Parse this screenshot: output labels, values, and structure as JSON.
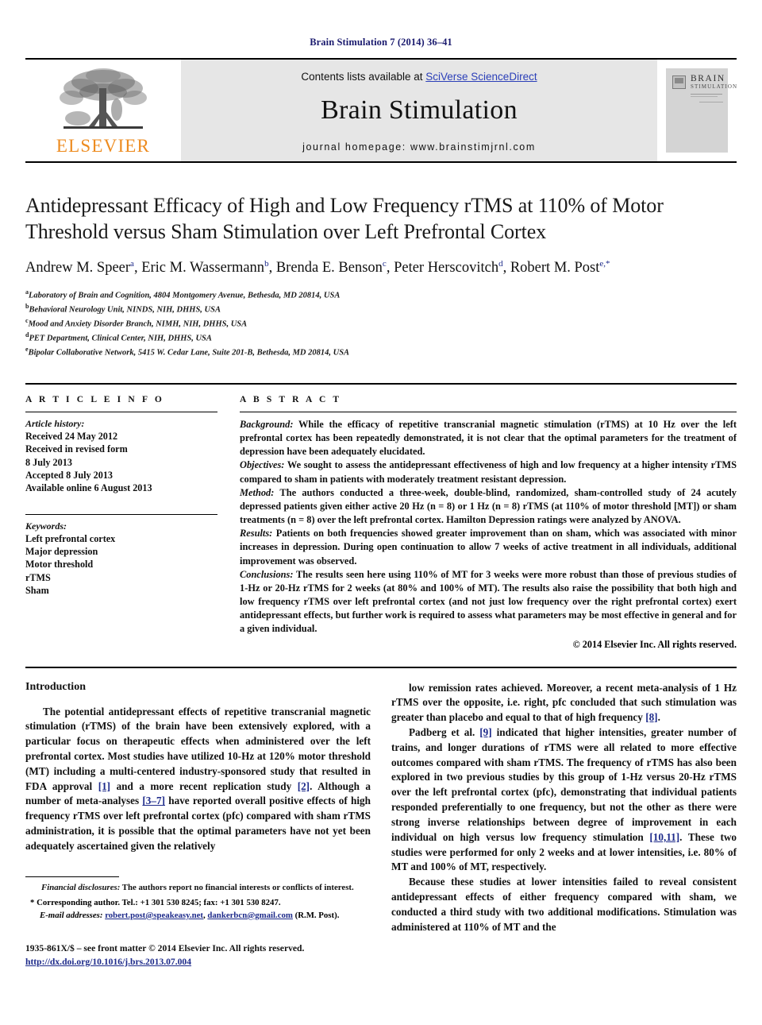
{
  "running_head": "Brain Stimulation 7 (2014) 36–41",
  "masthead": {
    "contents_prefix": "Contents lists available at ",
    "sciencedirect": "SciVerse ScienceDirect",
    "journal_name": "Brain Stimulation",
    "homepage": "journal homepage: www.brainstimjrnl.com",
    "publisher_word": "ELSEVIER",
    "cover": {
      "line1": "BRAIN",
      "line2": "STIMULATION"
    }
  },
  "article": {
    "title": "Antidepressant Efficacy of High and Low Frequency rTMS at 110% of Motor Threshold versus Sham Stimulation over Left Prefrontal Cortex",
    "authors": [
      {
        "name": "Andrew M. Speer",
        "sup": "a",
        "sep": ", "
      },
      {
        "name": "Eric M. Wassermann",
        "sup": "b",
        "sep": ", "
      },
      {
        "name": "Brenda E. Benson",
        "sup": "c",
        "sep": ", "
      },
      {
        "name": "Peter Herscovitch",
        "sup": "d",
        "sep": ", "
      },
      {
        "name": "Robert M. Post",
        "sup": "e,*",
        "sep": ""
      }
    ],
    "affiliations": [
      {
        "sup": "a",
        "text": "Laboratory of Brain and Cognition, 4804 Montgomery Avenue, Bethesda, MD 20814, USA"
      },
      {
        "sup": "b",
        "text": "Behavioral Neurology Unit, NINDS, NIH, DHHS, USA"
      },
      {
        "sup": "c",
        "text": "Mood and Anxiety Disorder Branch, NIMH, NIH, DHHS, USA"
      },
      {
        "sup": "d",
        "text": "PET Department, Clinical Center, NIH, DHHS, USA"
      },
      {
        "sup": "e",
        "text": "Bipolar Collaborative Network, 5415 W. Cedar Lane, Suite 201-B, Bethesda, MD 20814, USA"
      }
    ]
  },
  "info": {
    "heading": "A R T I C L E   I N F O",
    "history_label": "Article history:",
    "history": [
      "Received 24 May 2012",
      "Received in revised form",
      "8 July 2013",
      "Accepted 8 July 2013",
      "Available online 6 August 2013"
    ],
    "keywords_label": "Keywords:",
    "keywords": [
      "Left prefrontal cortex",
      "Major depression",
      "Motor threshold",
      "rTMS",
      "Sham"
    ]
  },
  "abstract": {
    "heading": "A B S T R A C T",
    "sections": [
      {
        "label": "Background:",
        "text": " While the efficacy of repetitive transcranial magnetic stimulation (rTMS) at 10 Hz over the left prefrontal cortex has been repeatedly demonstrated, it is not clear that the optimal parameters for the treatment of depression have been adequately elucidated."
      },
      {
        "label": "Objectives:",
        "text": " We sought to assess the antidepressant effectiveness of high and low frequency at a higher intensity rTMS compared to sham in patients with moderately treatment resistant depression."
      },
      {
        "label": "Method:",
        "text": " The authors conducted a three-week, double-blind, randomized, sham-controlled study of 24 acutely depressed patients given either active 20 Hz (n = 8) or 1 Hz (n = 8) rTMS (at 110% of motor threshold [MT]) or sham treatments (n = 8) over the left prefrontal cortex. Hamilton Depression ratings were analyzed by ANOVA."
      },
      {
        "label": "Results:",
        "text": " Patients on both frequencies showed greater improvement than on sham, which was associated with minor increases in depression. During open continuation to allow 7 weeks of active treatment in all individuals, additional improvement was observed."
      },
      {
        "label": "Conclusions:",
        "text": " The results seen here using 110% of MT for 3 weeks were more robust than those of previous studies of 1-Hz or 20-Hz rTMS for 2 weeks (at 80% and 100% of MT). The results also raise the possibility that both high and low frequency rTMS over left prefrontal cortex (and not just low frequency over the right prefrontal cortex) exert antidepressant effects, but further work is required to assess what parameters may be most effective in general and for a given individual."
      }
    ],
    "copyright": "© 2014 Elsevier Inc. All rights reserved."
  },
  "body": {
    "intro_heading": "Introduction",
    "left_paragraphs": [
      "The potential antidepressant effects of repetitive transcranial magnetic stimulation (rTMS) of the brain have been extensively explored, with a particular focus on therapeutic effects when administered over the left prefrontal cortex. Most studies have utilized 10-Hz at 120% motor threshold (MT) including a multi-centered industry-sponsored study that resulted in FDA approval [1] and a more recent replication study [2]. Although a number of meta-analyses [3–7] have reported overall positive effects of high frequency rTMS over left prefrontal cortex (pfc) compared with sham rTMS administration, it is possible that the optimal parameters have not yet been adequately ascertained given the relatively"
    ],
    "right_paragraphs": [
      "low remission rates achieved. Moreover, a recent meta-analysis of 1 Hz rTMS over the opposite, i.e. right, pfc concluded that such stimulation was greater than placebo and equal to that of high frequency [8].",
      "Padberg et al. [9] indicated that higher intensities, greater number of trains, and longer durations of rTMS were all related to more effective outcomes compared with sham rTMS. The frequency of rTMS has also been explored in two previous studies by this group of 1-Hz versus 20-Hz rTMS over the left prefrontal cortex (pfc), demonstrating that individual patients responded preferentially to one frequency, but not the other as there were strong inverse relationships between degree of improvement in each individual on high versus low frequency stimulation [10,11]. These two studies were performed for only 2 weeks and at lower intensities, i.e. 80% of MT and 100% of MT, respectively.",
      "Because these studies at lower intensities failed to reveal consistent antidepressant effects of either frequency compared with sham, we conducted a third study with two additional modifications. Stimulation was administered at 110% of MT and the"
    ]
  },
  "footnotes": {
    "financial_label": "Financial disclosures:",
    "financial_text": " The authors report no financial interests or conflicts of interest.",
    "corresponding": "* Corresponding author. Tel.: +1 301 530 8245; fax: +1 301 530 8247.",
    "email_label": "E-mail addresses:",
    "email_1": "robert.post@speakeasy.net",
    "email_sep": ", ",
    "email_2": "dankerbcn@gmail.com",
    "email_suffix": " (R.M. Post)."
  },
  "imprint": {
    "line1": "1935-861X/$ – see front matter © 2014 Elsevier Inc. All rights reserved.",
    "doi": "http://dx.doi.org/10.1016/j.brs.2013.07.004"
  },
  "colors": {
    "link_blue": "#1d2a8a",
    "sciencedirect_blue": "#2b3fb8",
    "elsevier_orange": "#ed8b1f",
    "masthead_gray": "#e6e6e6"
  }
}
